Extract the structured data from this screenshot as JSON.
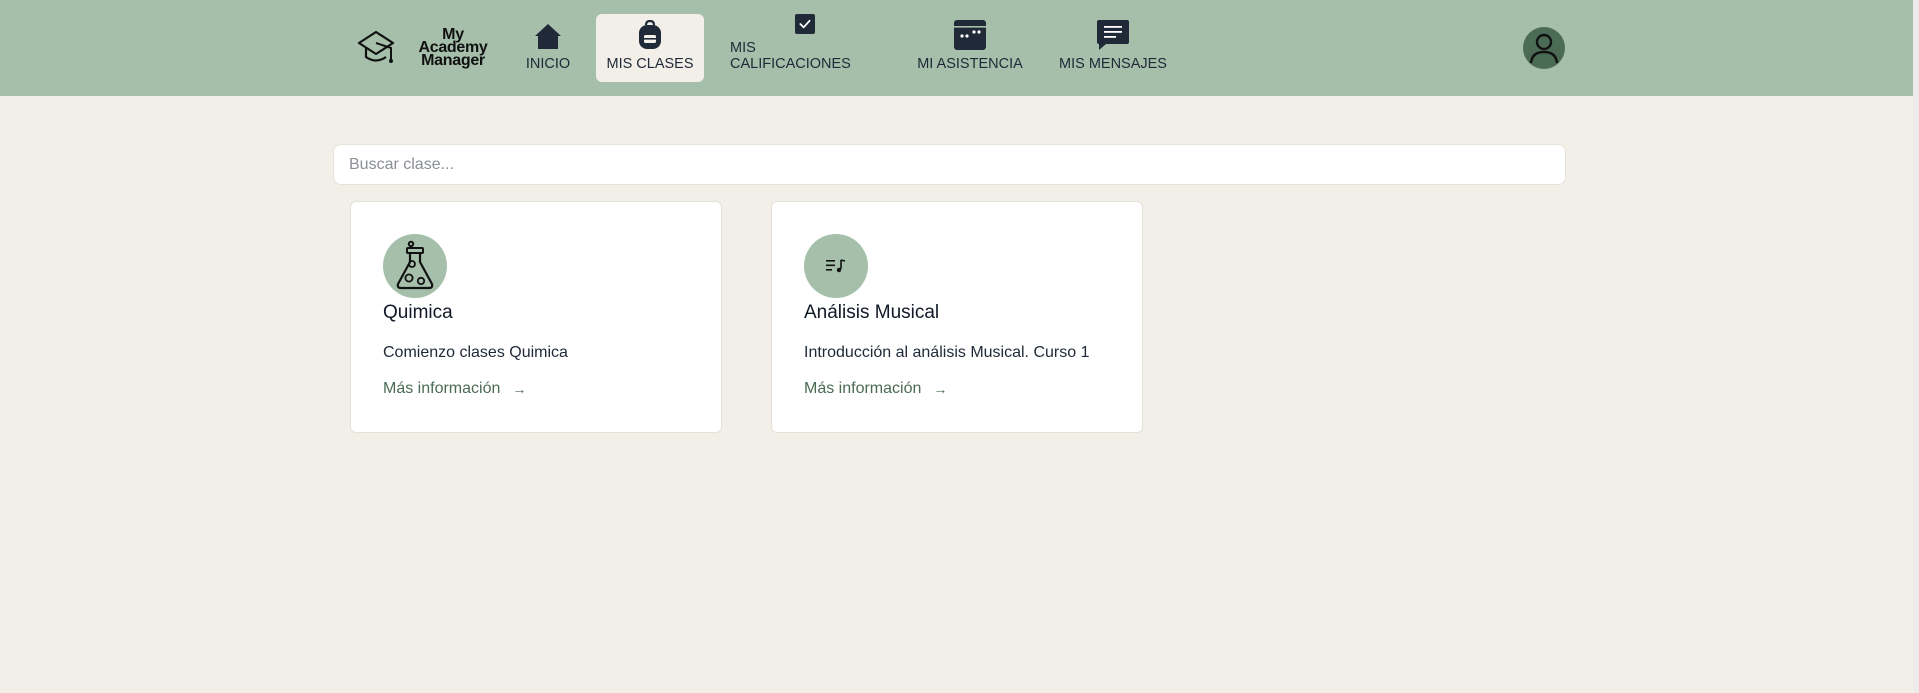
{
  "app": {
    "logo_text_lines": [
      "My",
      "Academy",
      "Manager"
    ]
  },
  "nav": {
    "items": [
      {
        "label": "INICIO",
        "icon": "home-icon"
      },
      {
        "label": "MIS CLASES",
        "icon": "backpack-icon",
        "active": true
      },
      {
        "label": "MIS CALIFICACIONES",
        "icon": "checkbox-icon"
      },
      {
        "label": "MI ASISTENCIA",
        "icon": "calendar-icon"
      },
      {
        "label": "MIS MENSAJES",
        "icon": "message-icon"
      }
    ]
  },
  "search": {
    "placeholder": "Buscar clase...",
    "value": ""
  },
  "classes": [
    {
      "title": "Quimica",
      "description": "Comienzo clases Quimica",
      "link": "Más información",
      "icon": "flask-icon"
    },
    {
      "title": "Análisis Musical",
      "description": "Introducción al análisis Musical. Curso 1",
      "link": "Más información",
      "icon": "music-list-icon"
    }
  ],
  "colors": {
    "navbar": "#a5bfab",
    "background": "#f1efe8",
    "accent_link": "#4b6b53",
    "avatar": "#4c6b55"
  }
}
